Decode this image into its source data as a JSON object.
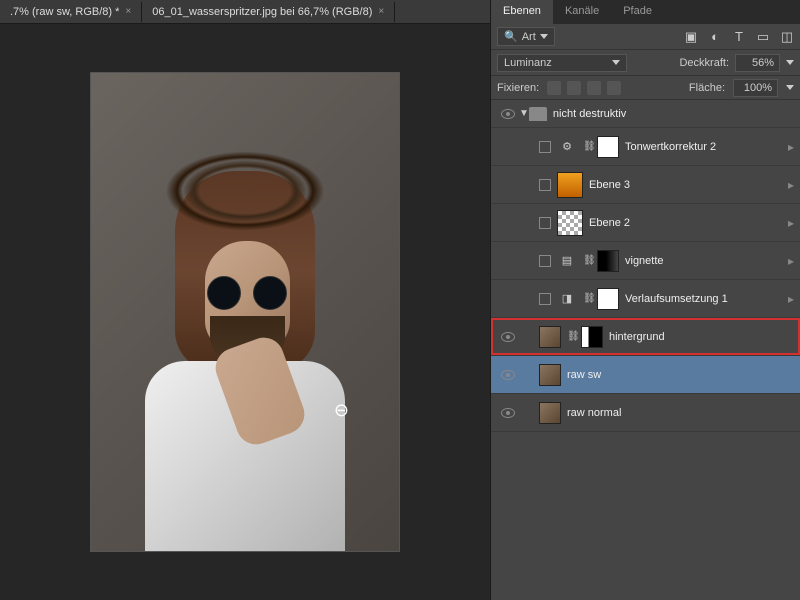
{
  "tabs": {
    "tab1": ".7% (raw sw, RGB/8) *",
    "tab2": "06_01_wasserspritzer.jpg bei 66,7% (RGB/8)"
  },
  "panel": {
    "ebenen": "Ebenen",
    "kanale": "Kanäle",
    "pfade": "Pfade"
  },
  "toolbar": {
    "search_label": "Art"
  },
  "opts": {
    "blend": "Luminanz",
    "opacity_label": "Deckkraft:",
    "opacity_val": "56%",
    "fix_label": "Fixieren:",
    "fill_label": "Fläche:",
    "fill_val": "100%"
  },
  "layers": {
    "group": "nicht destruktiv",
    "l1": "Tonwertkorrektur 2",
    "l2": "Ebene 3",
    "l3": "Ebene 2",
    "l4": "vignette",
    "l5": "Verlaufsumsetzung 1",
    "l6": "hintergrund",
    "l7": "raw sw",
    "l8": "raw normal"
  }
}
